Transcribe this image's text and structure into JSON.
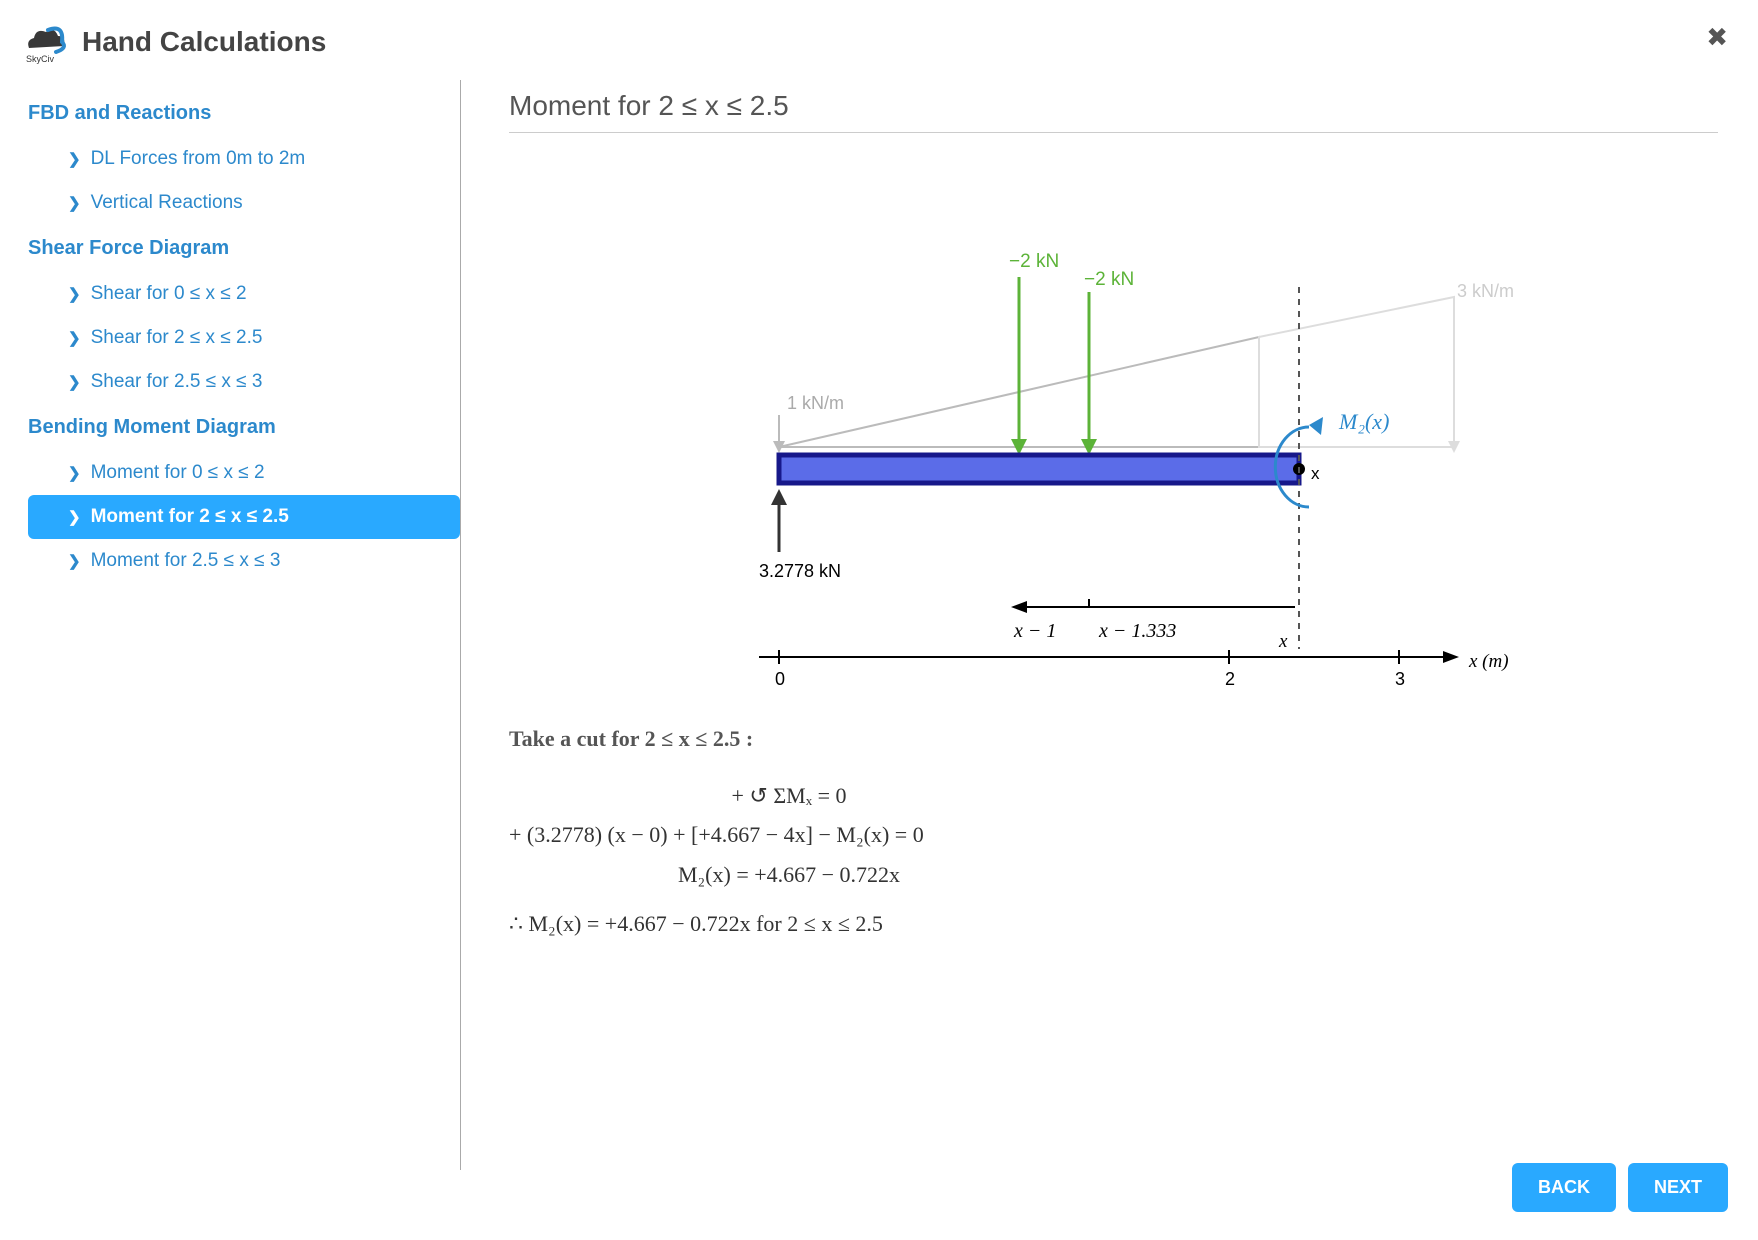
{
  "header": {
    "title": "Hand Calculations"
  },
  "sidebar": {
    "sections": [
      {
        "title": "FBD and Reactions",
        "items": [
          {
            "label": "DL Forces from 0m to 2m",
            "active": false
          },
          {
            "label": "Vertical Reactions",
            "active": false
          }
        ]
      },
      {
        "title": "Shear Force Diagram",
        "items": [
          {
            "label": "Shear for 0 ≤ x ≤ 2",
            "active": false
          },
          {
            "label": "Shear for 2 ≤ x ≤ 2.5",
            "active": false
          },
          {
            "label": "Shear for 2.5 ≤ x ≤ 3",
            "active": false
          }
        ]
      },
      {
        "title": "Bending Moment Diagram",
        "items": [
          {
            "label": "Moment for 0 ≤ x ≤ 2",
            "active": false
          },
          {
            "label": "Moment for 2 ≤ x ≤ 2.5",
            "active": true
          },
          {
            "label": "Moment for 2.5 ≤ x ≤ 3",
            "active": false
          }
        ]
      }
    ]
  },
  "page": {
    "title": "Moment for 2 ≤ x ≤ 2.5"
  },
  "diagram": {
    "loads": {
      "dist_left_label": "1 kN/m",
      "dist_right_label": "3 kN/m",
      "point1_label": "−2 kN",
      "point2_label": "−2 kN",
      "reaction_label": "3.2778 kN",
      "moment_label": "M₂(x)",
      "cut_label": "x",
      "dim1_label": "x − 1",
      "dim2_label": "x − 1.333",
      "axis_symbol": "x",
      "axis_unit": "x  (m)"
    },
    "ticks": {
      "t0": "0",
      "t2": "2",
      "t3": "3"
    }
  },
  "calc": {
    "intro": "Take a cut for 2 ≤ x ≤ 2.5 :",
    "line1": "+ ↺ ΣMₓ = 0",
    "line2": "+ (3.2778) (x − 0) + [+4.667 − 4x] − M₂(x) = 0",
    "line3": "M₂(x) = +4.667 − 0.722x",
    "line4": "∴ M₂(x) = +4.667 − 0.722x        for    2 ≤ x ≤ 2.5"
  },
  "footer": {
    "back": "BACK",
    "next": "NEXT"
  }
}
